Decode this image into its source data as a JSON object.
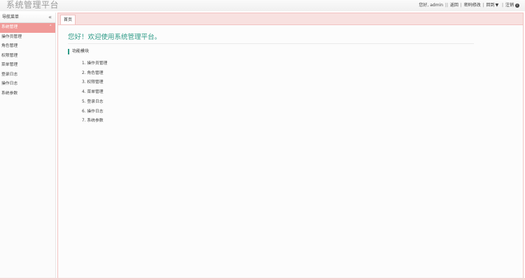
{
  "header": {
    "title": "系统管理平台",
    "user_label": "您好, admin",
    "links": [
      "返回",
      "密码修改",
      "回到",
      "注销"
    ]
  },
  "sidebar": {
    "title": "导航菜单",
    "items": [
      {
        "label": "系统管理"
      },
      {
        "label": "操作员管理"
      },
      {
        "label": "角色管理"
      },
      {
        "label": "权限管理"
      },
      {
        "label": "菜单管理"
      },
      {
        "label": "登录日志"
      },
      {
        "label": "操作日志"
      },
      {
        "label": "系统参数"
      }
    ]
  },
  "tabs": [
    {
      "label": "首页"
    }
  ],
  "main": {
    "welcome": "您好！欢迎使用系统管理平台。",
    "section_title": "功能模块",
    "modules": [
      "1. 操作员管理",
      "2. 角色管理",
      "3. 权限管理",
      "4. 菜单管理",
      "5. 登录日志",
      "6. 操作日志",
      "7. 系统参数"
    ]
  },
  "colors": {
    "accent": "#2d9a86",
    "active_menu": "#f09a98",
    "tab_bar": "#f8e1e0"
  }
}
